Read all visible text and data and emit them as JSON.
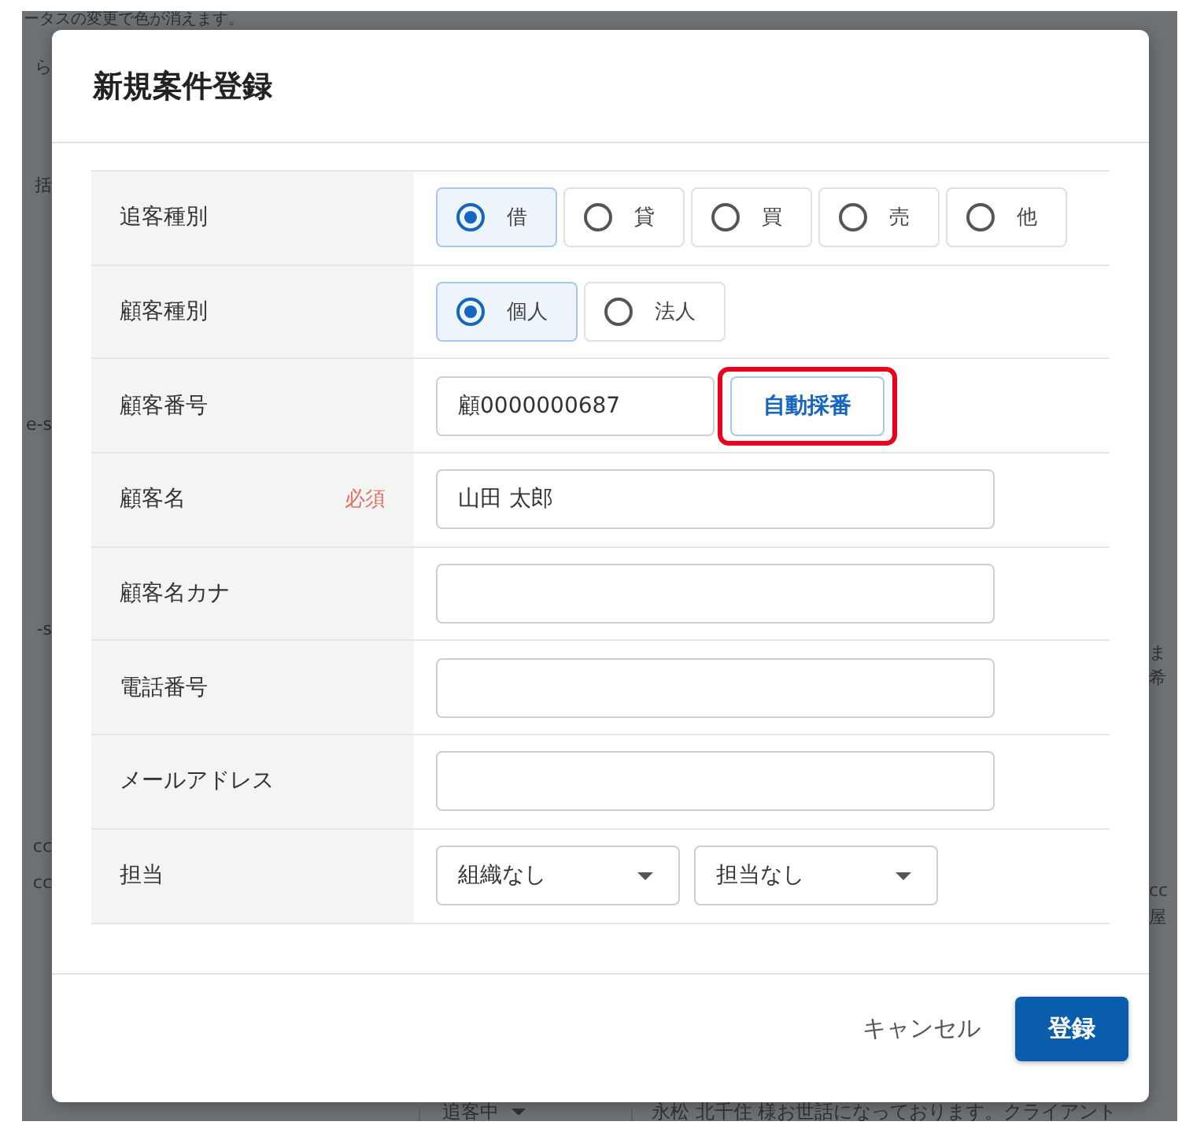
{
  "background": {
    "top_text": "ータスの変更で色が消えます。",
    "left": [
      "ら",
      "括",
      "e-s",
      "-s",
      "cc",
      "cc"
    ],
    "right": [
      "ま",
      "希",
      "cc",
      "屋"
    ],
    "bottom": {
      "status": "追客中",
      "message": "永松 北千住 様お世話になっております。クライアント"
    }
  },
  "dialog": {
    "title": "新規案件登録",
    "fields": [
      {
        "kind": "radio",
        "label": "追客種別",
        "options": [
          {
            "label": "借",
            "selected": true
          },
          {
            "label": "貸",
            "selected": false
          },
          {
            "label": "買",
            "selected": false
          },
          {
            "label": "売",
            "selected": false
          },
          {
            "label": "他",
            "selected": false
          }
        ]
      },
      {
        "kind": "radio",
        "label": "顧客種別",
        "options": [
          {
            "label": "個人",
            "selected": true
          },
          {
            "label": "法人",
            "selected": false
          }
        ]
      },
      {
        "kind": "number",
        "label": "顧客番号",
        "value": "顧0000000687",
        "button": {
          "label": "自動採番",
          "highlighted": true
        }
      },
      {
        "kind": "text",
        "label": "顧客名",
        "required": "必須",
        "value": "山田 太郎"
      },
      {
        "kind": "text",
        "label": "顧客名カナ"
      },
      {
        "kind": "text",
        "label": "電話番号"
      },
      {
        "kind": "text",
        "label": "メールアドレス"
      },
      {
        "kind": "selects",
        "label": "担当",
        "selects": [
          "組織なし",
          "担当なし"
        ]
      }
    ],
    "buttons": {
      "cancel": "キャンセル",
      "submit": "登録"
    }
  }
}
